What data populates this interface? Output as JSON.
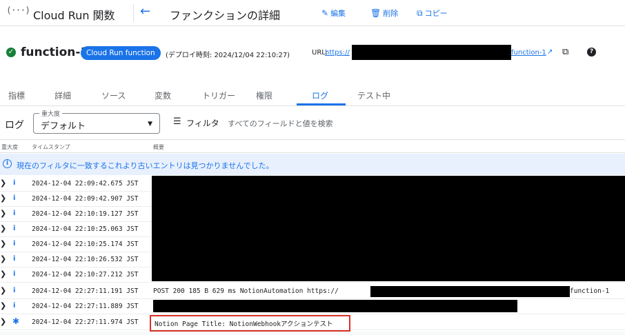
{
  "topbar": {
    "logo_glyph": "(···)",
    "product_name": "Cloud Run 関数",
    "back_glyph": "←",
    "page_heading": "ファンクションの詳細",
    "edit_label": "編集",
    "delete_label": "削除",
    "copy_label": "コピー"
  },
  "function": {
    "status_glyph": "✓",
    "name": "function-1",
    "badge": "Cloud Run function",
    "deploy_info": "(デプロイ時刻: 2024/12/04 22:10:27)",
    "url_label": "URL:",
    "url_prefix": "https://",
    "url_suffix": "function-1",
    "help_glyph": "?"
  },
  "tabs": [
    "指標",
    "詳細",
    "ソース",
    "変数",
    "トリガー",
    "権限",
    "ログ",
    "テスト中"
  ],
  "active_tab": "ログ",
  "logs_toolbar": {
    "title": "ログ",
    "severity_legend": "重大度",
    "severity_value": "デフォルト",
    "filter_label": "フィルタ",
    "filter_placeholder": "すべてのフィールドと値を検索"
  },
  "table": {
    "headers": [
      "重大度",
      "タイムスタンプ",
      "概要"
    ],
    "banner": "現在のフィルタに一致するこれより古いエントリは見つかりませんでした。",
    "rows": [
      {
        "severity": "info",
        "timestamp": "2024-12-04 22:09:42.675 JST",
        "summary": ""
      },
      {
        "severity": "info",
        "timestamp": "2024-12-04 22:09:42.907 JST",
        "summary": ""
      },
      {
        "severity": "info",
        "timestamp": "2024-12-04 22:10:19.127 JST",
        "summary": ""
      },
      {
        "severity": "info",
        "timestamp": "2024-12-04 22:10:25.063 JST",
        "summary": ""
      },
      {
        "severity": "info",
        "timestamp": "2024-12-04 22:10:25.174 JST",
        "summary": ""
      },
      {
        "severity": "info",
        "timestamp": "2024-12-04 22:10:26.532 JST",
        "summary": ""
      },
      {
        "severity": "info",
        "timestamp": "2024-12-04 22:10:27.212 JST",
        "summary": ""
      },
      {
        "severity": "info",
        "timestamp": "2024-12-04 22:27:11.191 JST",
        "summary": "POST  200  185 B  629 ms  NotionAutomation   https://",
        "summary_tail": "function-1"
      },
      {
        "severity": "info",
        "timestamp": "2024-12-04 22:27:11.889 JST",
        "summary": ""
      },
      {
        "severity": "default",
        "timestamp": "2024-12-04 22:27:11.974 JST",
        "summary": "Notion Page Title: NotionWebhookアクションテスト"
      }
    ]
  },
  "colors": {
    "accent": "#1a73e8",
    "success": "#188038",
    "highlight": "#d93025",
    "banner_bg": "#e8f0fe"
  },
  "icons": {
    "edit": "pencil-icon",
    "delete": "trash-icon",
    "copy": "copy-icon",
    "external": "open-in-new-icon",
    "help": "help-icon",
    "filter": "filter-icon",
    "expand": "chevron-right-icon",
    "info": "info-icon",
    "default": "asterisk-icon"
  }
}
